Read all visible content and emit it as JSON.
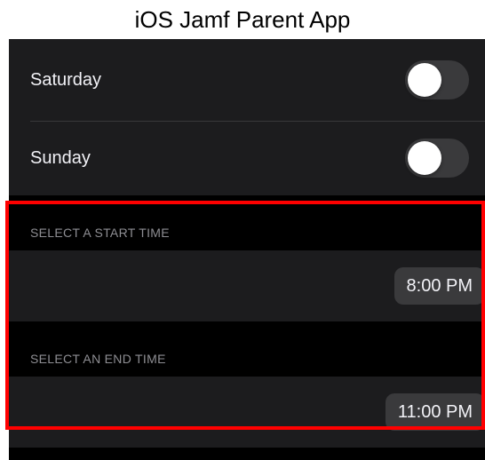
{
  "caption": "iOS Jamf Parent App",
  "days": [
    {
      "label": "Saturday",
      "enabled": false
    },
    {
      "label": "Sunday",
      "enabled": false
    }
  ],
  "start_time": {
    "header": "SELECT A START TIME",
    "value": "8:00 PM"
  },
  "end_time": {
    "header": "SELECT AN END TIME",
    "value": "11:00 PM"
  },
  "colors": {
    "background": "#1c1c1e",
    "section_background": "#000000",
    "text": "#f2f2f7",
    "secondary_text": "#8e8e93",
    "control_fill": "#3a3a3c",
    "highlight": "#ff0000"
  }
}
